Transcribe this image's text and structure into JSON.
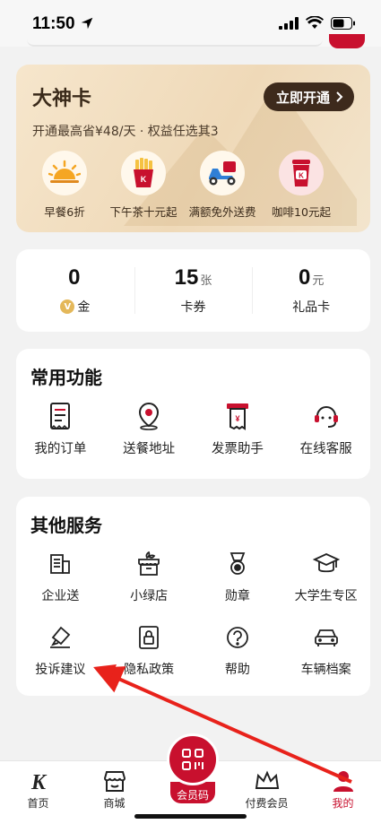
{
  "status_bar": {
    "time": "11:50"
  },
  "dashen_card": {
    "title": "大神卡",
    "cta_label": "立即开通",
    "subtitle": "开通最高省¥48/天 · 权益任选其3",
    "benefits": [
      {
        "label": "早餐6折",
        "icon": "sunrise-icon"
      },
      {
        "label": "下午茶十元起",
        "icon": "fries-icon"
      },
      {
        "label": "满额免外送费",
        "icon": "delivery-scooter-icon"
      },
      {
        "label": "咖啡10元起",
        "icon": "coffee-cup-icon"
      }
    ]
  },
  "assets": [
    {
      "value": "0",
      "unit": "",
      "label": "金",
      "icon": "coin-icon",
      "coin_glyph": "V"
    },
    {
      "value": "15",
      "unit": "张",
      "label": "卡券"
    },
    {
      "value": "0",
      "unit": "元",
      "label": "礼品卡"
    }
  ],
  "common_functions": {
    "title": "常用功能",
    "items": [
      {
        "label": "我的订单",
        "icon": "order-list-icon"
      },
      {
        "label": "送餐地址",
        "icon": "location-pin-icon"
      },
      {
        "label": "发票助手",
        "icon": "invoice-icon"
      },
      {
        "label": "在线客服",
        "icon": "headset-icon"
      }
    ]
  },
  "other_services": {
    "title": "其他服务",
    "row1": [
      {
        "label": "企业送",
        "icon": "building-icon"
      },
      {
        "label": "小绿店",
        "icon": "green-store-icon"
      },
      {
        "label": "勋章",
        "icon": "medal-icon"
      },
      {
        "label": "大学生专区",
        "icon": "graduation-cap-icon"
      }
    ],
    "row2": [
      {
        "label": "投诉建议",
        "icon": "feedback-edit-icon"
      },
      {
        "label": "隐私政策",
        "icon": "privacy-lock-icon"
      },
      {
        "label": "帮助",
        "icon": "help-icon"
      },
      {
        "label": "车辆档案",
        "icon": "car-icon"
      }
    ]
  },
  "bottom_nav": {
    "items": [
      {
        "label": "首页",
        "icon": "kfc-logo-icon"
      },
      {
        "label": "商城",
        "icon": "store-icon"
      },
      {
        "label": "会员码",
        "icon": "member-code-icon"
      },
      {
        "label": "付费会员",
        "icon": "crown-icon"
      },
      {
        "label": "我的",
        "icon": "user-icon",
        "active": true
      }
    ]
  },
  "colors": {
    "brand_red": "#c8102e",
    "card_gold": "#f3e3c8",
    "annotation_red": "#e8221b"
  }
}
